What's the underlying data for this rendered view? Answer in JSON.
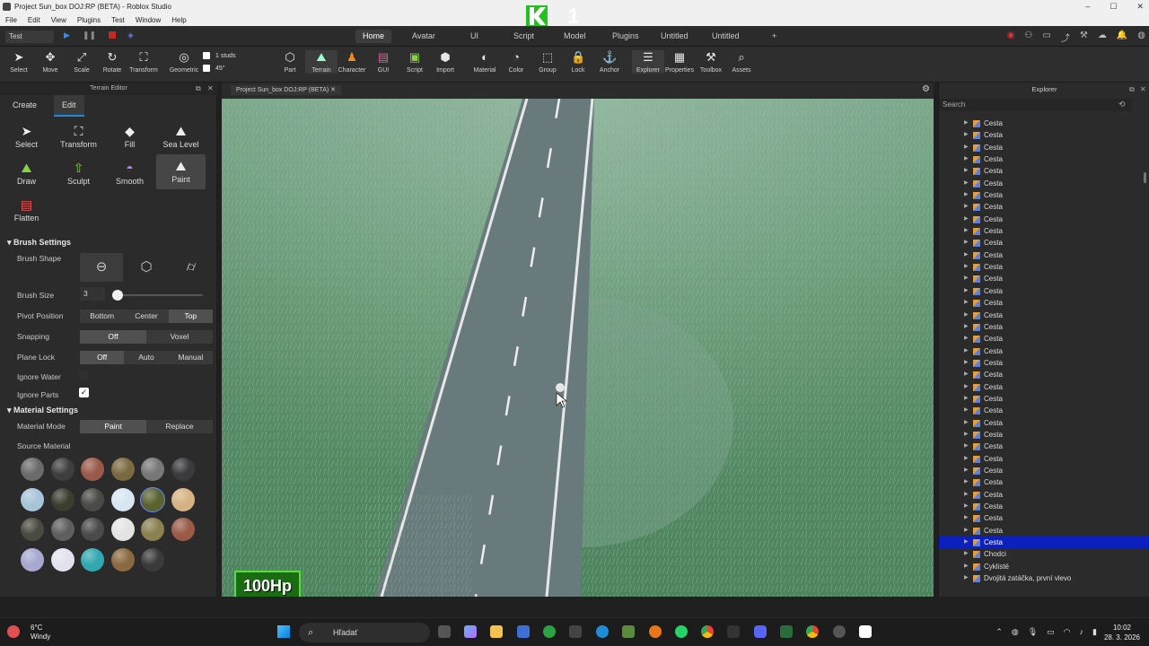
{
  "window": {
    "title": "Project Sun_box DOJ:RP (BETA) - Roblox Studio"
  },
  "menu": [
    "File",
    "Edit",
    "View",
    "Plugins",
    "Test",
    "Window",
    "Help"
  ],
  "overlay": {
    "logo_text": "1"
  },
  "topbar": {
    "test_select": "Test",
    "tabs": [
      {
        "label": "Home",
        "active": true
      },
      {
        "label": "Avatar",
        "active": false
      },
      {
        "label": "UI",
        "active": false
      },
      {
        "label": "Script",
        "active": false
      },
      {
        "label": "Model",
        "active": false
      },
      {
        "label": "Plugins",
        "active": false
      },
      {
        "label": "Untitled",
        "active": false
      },
      {
        "label": "Untitled",
        "active": false
      },
      {
        "label": "+",
        "active": false
      }
    ]
  },
  "ribbon": {
    "tools": [
      "Select",
      "Move",
      "Scale",
      "Rotate",
      "Transform",
      "Geometric",
      "Part",
      "Terrain",
      "Character",
      "GUI",
      "Script",
      "Import",
      "Material",
      "Color",
      "Group",
      "Lock",
      "Anchor",
      "Explorer",
      "Properties",
      "Toolbox",
      "Assets"
    ],
    "studs": "1 studs",
    "angle": "45°"
  },
  "terrain_editor": {
    "title": "Terrain Editor",
    "tabs": [
      "Create",
      "Edit"
    ],
    "tools": [
      "Select",
      "Transform",
      "Fill",
      "Sea Level",
      "Draw",
      "Sculpt",
      "Smooth",
      "Paint",
      "Flatten"
    ],
    "selected_tool": "Paint",
    "brush_settings": {
      "header": "Brush Settings",
      "brush_shape_label": "Brush Shape",
      "brush_size_label": "Brush Size",
      "brush_size_value": "3",
      "brush_size_fraction": 0.05,
      "pivot_label": "Pivot Position",
      "pivot_options": [
        "Bottom",
        "Center",
        "Top"
      ],
      "snapping_label": "Snapping",
      "snapping_options": [
        "Off",
        "Voxel"
      ],
      "planelock_label": "Plane Lock",
      "planelock_options": [
        "Off",
        "Auto",
        "Manual"
      ],
      "ignore_water_label": "Ignore Water",
      "ignore_water_checked": false,
      "ignore_parts_label": "Ignore Parts",
      "ignore_parts_checked": true
    },
    "material_settings": {
      "header": "Material Settings",
      "mode_label": "Material Mode",
      "mode_options": [
        "Paint",
        "Replace"
      ],
      "source_label": "Source Material",
      "materials": [
        "#6a6a6a",
        "#3e3e3e",
        "#9a5a4a",
        "#7a6a40",
        "#777777",
        "#3a3a3c",
        "#a8c4d8",
        "#3a3d30",
        "#4a4a46",
        "#d8e6f2",
        "#5a6330",
        "#d6b384",
        "#4a4a40",
        "#5e5e5e",
        "#4a4a4a",
        "#e4e4e4",
        "#8a8050",
        "#9a5a48",
        "#a8a8d0",
        "#e2e2ee",
        "#31a8b0",
        "#8a6a40",
        "#3a3a3a"
      ]
    }
  },
  "viewport": {
    "tab_label": "Project Sun_box DOJ:RP (BETA)",
    "hud_hp": "100Hp"
  },
  "explorer": {
    "title": "Explorer",
    "search_placeholder": "Search",
    "items": [
      "Cesta",
      "Cesta",
      "Cesta",
      "Cesta",
      "Cesta",
      "Cesta",
      "Cesta",
      "Cesta",
      "Cesta",
      "Cesta",
      "Cesta",
      "Cesta",
      "Cesta",
      "Cesta",
      "Cesta",
      "Cesta",
      "Cesta",
      "Cesta",
      "Cesta",
      "Cesta",
      "Cesta",
      "Cesta",
      "Cesta",
      "Cesta",
      "Cesta",
      "Cesta",
      "Cesta",
      "Cesta",
      "Cesta",
      "Cesta",
      "Cesta",
      "Cesta",
      "Cesta",
      "Cesta",
      "Cesta",
      "Cesta",
      "Chodci",
      "Cyklisté",
      "Dvojitá zatáčka, první vlevo"
    ],
    "selected_index": 35
  },
  "taskbar": {
    "weather_temp": "6°C",
    "weather_desc": "Windy",
    "search_placeholder": "Hľadať",
    "time": "10:02",
    "date": "28. 3. 2026"
  }
}
